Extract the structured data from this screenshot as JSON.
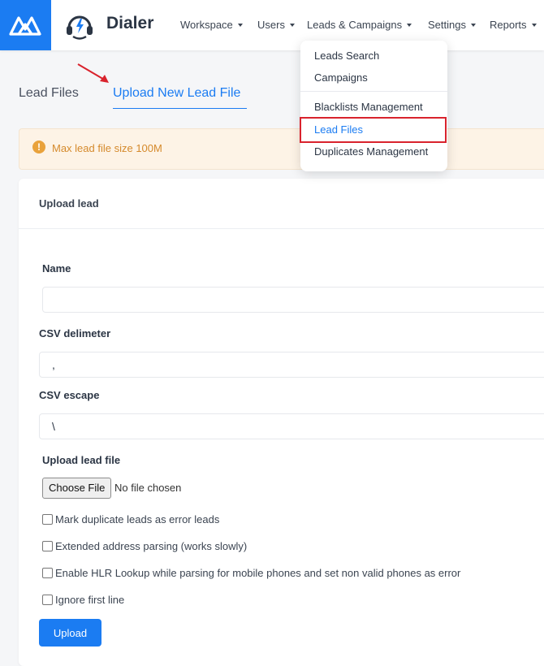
{
  "app": {
    "name": "Dialer"
  },
  "nav": {
    "items": [
      {
        "label": "Workspace"
      },
      {
        "label": "Users"
      },
      {
        "label": "Leads & Campaigns"
      },
      {
        "label": "Settings"
      },
      {
        "label": "Reports"
      }
    ]
  },
  "tabs": [
    {
      "label": "Lead Files",
      "active": false
    },
    {
      "label": "Upload New Lead File",
      "active": true
    }
  ],
  "alert": {
    "text": "Max lead file size 100M",
    "icon": "info-circle-icon"
  },
  "form": {
    "title": "Upload lead",
    "name": {
      "label": "Name",
      "value": ""
    },
    "csv_delimiter": {
      "label": "CSV delimeter",
      "value": ","
    },
    "csv_escape": {
      "label": "CSV escape",
      "value": "\\"
    },
    "file": {
      "label": "Upload lead file",
      "button": "Choose File",
      "status": "No file chosen"
    },
    "checkboxes": [
      {
        "label": "Mark duplicate leads as error leads",
        "checked": false
      },
      {
        "label": "Extended address parsing (works slowly)",
        "checked": false
      },
      {
        "label": "Enable HLR Lookup while parsing for mobile phones and set non valid phones as error",
        "checked": false
      },
      {
        "label": "Ignore first line",
        "checked": false
      }
    ],
    "submit": "Upload"
  },
  "dropdown": {
    "items": [
      {
        "label": "Leads Search"
      },
      {
        "label": "Campaigns"
      },
      {
        "label": "Blacklists Management"
      },
      {
        "label": "Lead Files",
        "highlighted": true
      },
      {
        "label": "Duplicates Management"
      }
    ]
  },
  "colors": {
    "primary": "#1b7cf2",
    "alert_bg": "#fdf3e6",
    "alert_text": "#d58a2c",
    "highlight": "#d9232d",
    "arrow": "#d9232d"
  }
}
